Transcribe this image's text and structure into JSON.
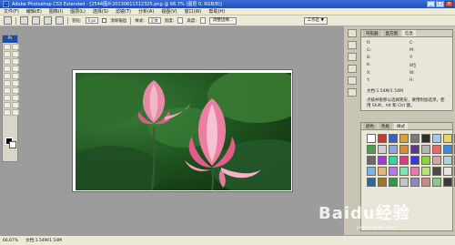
{
  "window": {
    "app_icon": "Ps",
    "title": "Adobe Photoshop CS3 Extended - [2544图片20130611312325.png @ 66.7% (图层 0, RGB/8)]",
    "buttons": [
      "_",
      "□",
      "×"
    ]
  },
  "menubar": {
    "items": [
      "文件(F)",
      "编辑(E)",
      "图像(I)",
      "图层(L)",
      "选择(S)",
      "滤镜(T)",
      "分析(A)",
      "视图(V)",
      "窗口(W)",
      "帮助(H)"
    ]
  },
  "options": {
    "feather_label": "羽化:",
    "feather_value": "0 px",
    "antialias_label": "消除锯齿",
    "style_label": "样式:",
    "style_value": "正常",
    "width_label": "宽度:",
    "height_label": "高度:",
    "refine_label": "调整边缘...",
    "workspace_label": "工作区 ▼"
  },
  "toolbox": {
    "header": "Ps",
    "tool_count": 20
  },
  "document": {
    "subject": "pink lotus flowers with green leaves"
  },
  "status": {
    "zoom": "66.67%",
    "doc_info": "文档:1.54M/1.54M"
  },
  "info_panel": {
    "tabs": [
      "导航器",
      "直方图",
      "信息"
    ],
    "active_tab": "信息",
    "readouts": [
      "R:",
      "C:",
      "G:",
      "M:",
      "B:",
      "Y:",
      "K:",
      "8位",
      "X:",
      "W:",
      "Y:",
      "H:"
    ],
    "doc_line": "文档:1.54M/1.54M",
    "help_text": "点按并拖移以选择矩形，要用附加选项，使用 Shift、Alt 和 Ctrl 键。"
  },
  "styles_panel": {
    "tabs": [
      "颜色",
      "色板",
      "样式"
    ],
    "active_tab": "样式",
    "swatch_colors": [
      "#ffffff",
      "#c03a3a",
      "#3a5fbf",
      "#d6a43a",
      "#7a7a7a",
      "#2e2e2e",
      "#a6c7e8",
      "#e8d36a",
      "#9b4fb3",
      "#4f9b56",
      "#cfcfcf",
      "#8aa9d6",
      "#d68a3a",
      "#5a3a8a",
      "#b3b3b3",
      "#e86a6a",
      "#3a8ad6",
      "#d6d63a",
      "#6a6a6a",
      "#a63ad6",
      "#3ad6a6",
      "#d63a8a",
      "#3a3ad6",
      "#8ad63a",
      "#d6a6a6",
      "#a6d6d6",
      "#5a5a5a",
      "#7bb3e6",
      "#e6b37b",
      "#b37be6",
      "#7be6b3",
      "#e67bb3",
      "#b3e67b",
      "#4a4a4a",
      "#e6e6e6",
      "#9a2a2a",
      "#2a6a9a",
      "#9a7a2a",
      "#2a9a4a",
      "#c6c6c6",
      "#8a8ac6",
      "#c68a8a",
      "#8ac68a",
      "#3a3a3a",
      "#f0d090"
    ]
  },
  "watermark": {
    "text": "Baidu经验",
    "sub": "jingyan.baidu.com"
  }
}
